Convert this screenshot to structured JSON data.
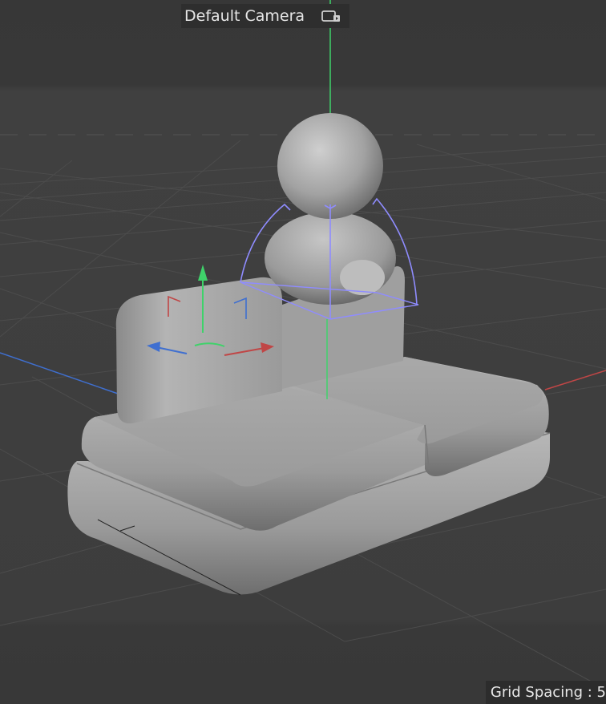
{
  "camera": {
    "label": "Default Camera",
    "icon": "camera-icon"
  },
  "status": {
    "grid_spacing": "Grid Spacing : 5"
  },
  "colors": {
    "background_top": "#373737",
    "background_mid": "#3d3d3d",
    "axis_x": "#c04646",
    "axis_y": "#3fd26a",
    "axis_z": "#3f6fd0",
    "selection_outline": "#8f8cff",
    "model": "#a4a4a4"
  }
}
